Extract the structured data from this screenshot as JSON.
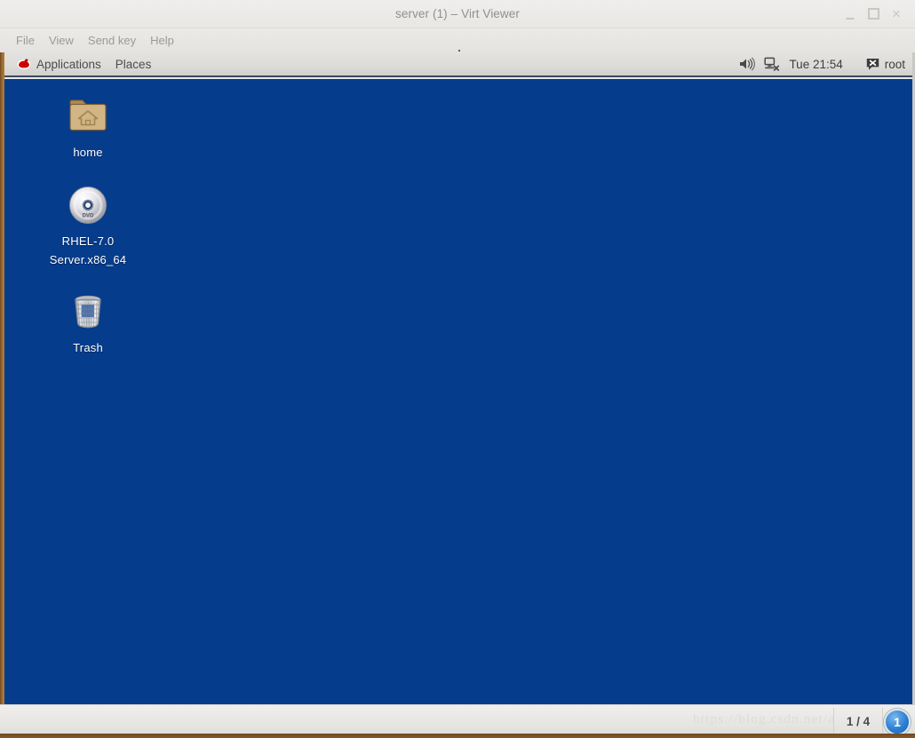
{
  "window": {
    "title": "server (1) – Virt Viewer",
    "controls": {
      "minimize": "–",
      "maximize": "□",
      "close": "×"
    }
  },
  "menubar": {
    "items": [
      {
        "label": "File"
      },
      {
        "label": "View"
      },
      {
        "label": "Send key"
      },
      {
        "label": "Help"
      }
    ]
  },
  "panel": {
    "applications_label": "Applications",
    "places_label": "Places",
    "clock": "Tue 21:54",
    "user": "root",
    "icons": {
      "logo": "redhat-logo",
      "volume": "volume-icon",
      "network": "network-disconnected-icon",
      "messages": "messaging-icon"
    }
  },
  "desktop": {
    "background_color": "#053c8c",
    "icons": [
      {
        "name": "home",
        "label": "home",
        "icon": "home-folder-icon"
      },
      {
        "name": "dvd",
        "label": "RHEL-7.0 Server.x86_64",
        "icon": "dvd-disc-icon"
      },
      {
        "name": "trash",
        "label": "Trash",
        "icon": "trash-can-icon"
      }
    ]
  },
  "statusbar": {
    "watermark": "https://blog.csdn.net/aa",
    "page_indicator": "1 / 4",
    "badge": "1"
  }
}
